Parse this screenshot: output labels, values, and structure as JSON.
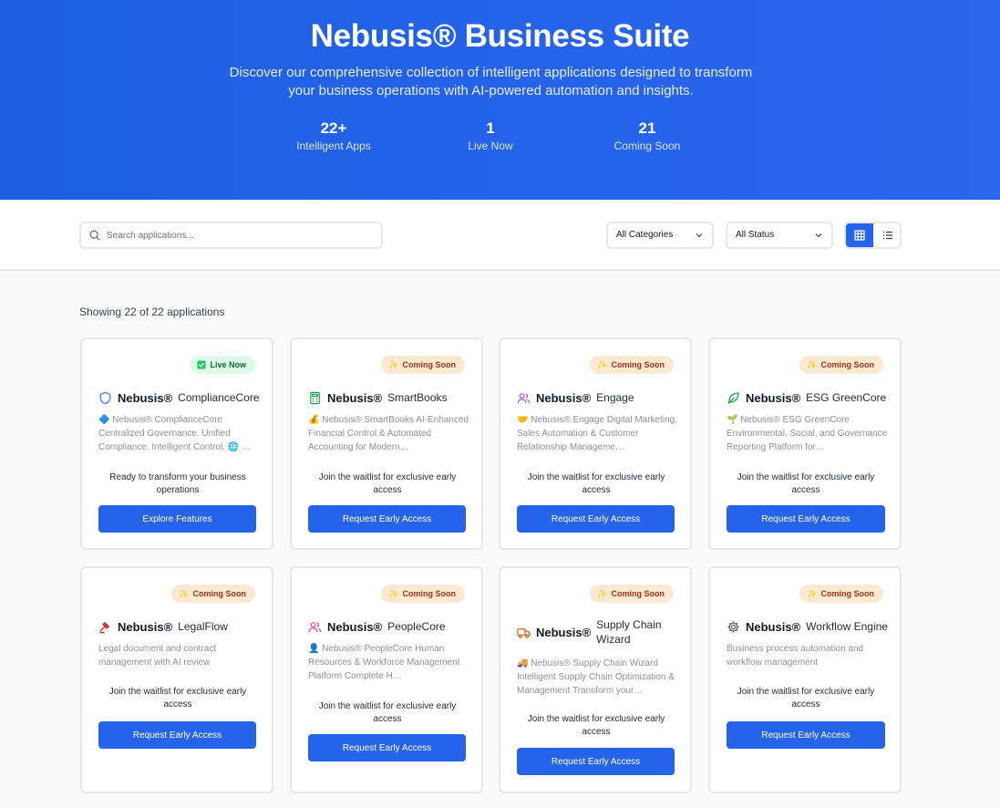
{
  "hero": {
    "title": "Nebusis® Business Suite",
    "subtitle": "Discover our comprehensive collection of intelligent applications designed to transform your business operations with AI-powered automation and insights.",
    "stats": [
      {
        "value": "22+",
        "label": "Intelligent Apps"
      },
      {
        "value": "1",
        "label": "Live Now"
      },
      {
        "value": "21",
        "label": "Coming Soon"
      }
    ]
  },
  "toolbar": {
    "search_placeholder": "Search applications...",
    "category_filter": "All Categories",
    "status_filter": "All Status"
  },
  "results": {
    "showing_text": "Showing 22 of 22 applications"
  },
  "apps": [
    {
      "badge": "Live Now",
      "badge_type": "live",
      "badge_icon": "check-square-icon",
      "brand": "Nebusis®",
      "name": "ComplianceCore",
      "icon": "shield-icon",
      "icon_color": "#3b82f6",
      "description": "🔷 Nebusis® ComplianceCore Centralized Governance. Unified Compliance. Intelligent Control. 🌐 …",
      "cta_text": "Ready to transform your business operations",
      "button": "Explore Features"
    },
    {
      "badge": "Coming Soon",
      "badge_type": "soon",
      "badge_icon": "sparkle-icon",
      "brand": "Nebusis®",
      "name": "SmartBooks",
      "icon": "calculator-icon",
      "icon_color": "#16a34a",
      "description": "💰 Nebusis® SmartBooks AI-Enhanced Financial Control & Automated Accounting for Modern…",
      "cta_text": "Join the waitlist for exclusive early access",
      "button": "Request Early Access"
    },
    {
      "badge": "Coming Soon",
      "badge_type": "soon",
      "badge_icon": "sparkle-icon",
      "brand": "Nebusis®",
      "name": "Engage",
      "icon": "users-icon",
      "icon_color": "#a855f7",
      "description": "🤝 Nebusis® Engage Digital Marketing, Sales Automation & Customer Relationship Manageme…",
      "cta_text": "Join the waitlist for exclusive early access",
      "button": "Request Early Access"
    },
    {
      "badge": "Coming Soon",
      "badge_type": "soon",
      "badge_icon": "sparkle-icon",
      "brand": "Nebusis®",
      "name": "ESG GreenCore",
      "icon": "leaf-icon",
      "icon_color": "#16a34a",
      "description": "🌱 Nebusis® ESG GreenCore Environmental, Social, and Governance Reporting Platform for…",
      "cta_text": "Join the waitlist for exclusive early access",
      "button": "Request Early Access"
    },
    {
      "badge": "Coming Soon",
      "badge_type": "soon",
      "badge_icon": "sparkle-icon",
      "brand": "Nebusis®",
      "name": "LegalFlow",
      "icon": "gavel-icon",
      "icon_color": "#dc2626",
      "description": "Legal document and contract management with AI review",
      "cta_text": "Join the waitlist for exclusive early access",
      "button": "Request Early Access"
    },
    {
      "badge": "Coming Soon",
      "badge_type": "soon",
      "badge_icon": "sparkle-icon",
      "brand": "Nebusis®",
      "name": "PeopleCore",
      "icon": "users-icon",
      "icon_color": "#ec4899",
      "description": "👤 Nebusis® PeopleCore Human Resources & Workforce Management Platform Complete H…",
      "cta_text": "Join the waitlist for exclusive early access",
      "button": "Request Early Access"
    },
    {
      "badge": "Coming Soon",
      "badge_type": "soon",
      "badge_icon": "sparkle-icon",
      "brand": "Nebusis®",
      "name": "Supply Chain Wizard",
      "icon": "truck-icon",
      "icon_color": "#ea580c",
      "description": "🚚 Nebusis® Supply Chain Wizard Intelligent Supply Chain Optimization & Management Transform your…",
      "cta_text": "Join the waitlist for exclusive early access",
      "button": "Request Early Access"
    },
    {
      "badge": "Coming Soon",
      "badge_type": "soon",
      "badge_icon": "sparkle-icon",
      "brand": "Nebusis®",
      "name": "Workflow Engine",
      "icon": "cog-icon",
      "icon_color": "#4b5563",
      "description": "Business process automation and workflow management",
      "cta_text": "Join the waitlist for exclusive early access",
      "button": "Request Early Access"
    }
  ]
}
